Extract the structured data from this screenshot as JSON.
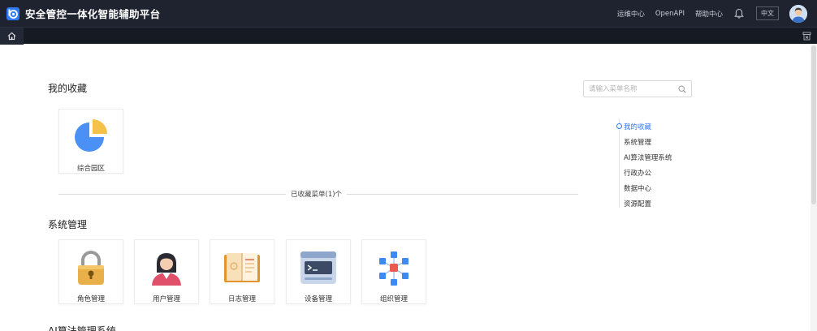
{
  "header": {
    "title": "安全管控一体化智能辅助平台",
    "links": [
      "运维中心",
      "OpenAPI",
      "帮助中心"
    ],
    "language": "中文"
  },
  "search": {
    "placeholder": "请输入菜单名称"
  },
  "favorites": {
    "title": "我的收藏",
    "items": [
      {
        "label": "综合园区",
        "icon": "pie-chart-icon"
      }
    ],
    "summary": "已收藏菜单(1)个"
  },
  "system": {
    "title": "系统管理",
    "items": [
      {
        "label": "角色管理",
        "icon": "lock-icon"
      },
      {
        "label": "用户管理",
        "icon": "user-icon"
      },
      {
        "label": "日志管理",
        "icon": "log-book-icon"
      },
      {
        "label": "设备管理",
        "icon": "device-icon"
      },
      {
        "label": "组织管理",
        "icon": "org-cubes-icon"
      }
    ]
  },
  "ai_section": {
    "title": "AI算法管理系统"
  },
  "anchor_nav": {
    "items": [
      "我的收藏",
      "系统管理",
      "AI算法管理系统",
      "行政办公",
      "数据中心",
      "资源配置"
    ],
    "active_index": 0
  },
  "colors": {
    "header_bg": "#1f2330",
    "accent": "#2f7cf6"
  }
}
